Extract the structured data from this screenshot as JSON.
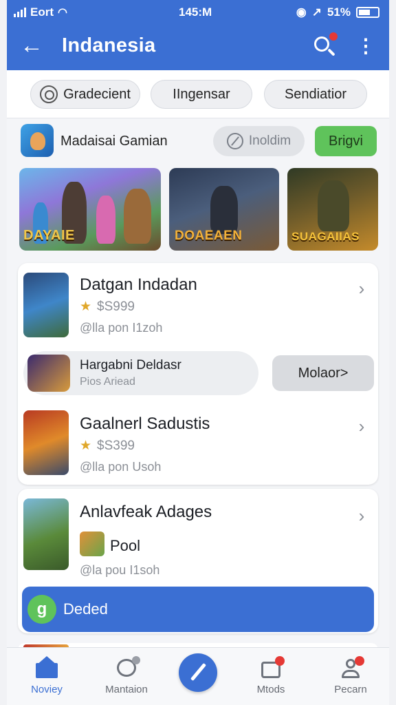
{
  "status": {
    "carrier": "Eort",
    "time": "145:M",
    "battery": "51%"
  },
  "appbar": {
    "title": "Indanesia"
  },
  "chips": [
    "Gradecient",
    "IIngensar",
    "Sendiatior"
  ],
  "featured": {
    "label": "Madaisai Gamian",
    "secondary_button": "Inoldim",
    "primary_button": "Brigvi",
    "banners": [
      "DAYAIE",
      "DOAEAEN",
      "SUAGAIIAS"
    ]
  },
  "list": [
    {
      "name": "Datgan Indadan",
      "price": "$S999",
      "sub": "@lla pon I1zoh"
    },
    {
      "name": "Gaalnerl Sadustis",
      "price": "$S399",
      "sub": "@lla pon Usoh"
    }
  ],
  "promo": {
    "title": "Hargabni Deldasr",
    "subtitle": "Pios Ariead",
    "button": "Molaor>"
  },
  "card2": {
    "name": "Anlavfeak Adages",
    "pool": "Pool",
    "sub": "@la pou I1soh",
    "button": "Deded"
  },
  "nav": [
    {
      "label": "Noviey",
      "icon": "home-icon"
    },
    {
      "label": "Mantaion",
      "icon": "chat-bubble-icon"
    },
    {
      "label": "",
      "icon": "pen-icon"
    },
    {
      "label": "Mtods",
      "icon": "inbox-icon"
    },
    {
      "label": "Pecarn",
      "icon": "person-icon"
    }
  ],
  "colors": {
    "primary": "#3b6fd3",
    "accent_green": "#5fc35b",
    "badge_red": "#e53935",
    "star": "#e0a72a"
  }
}
